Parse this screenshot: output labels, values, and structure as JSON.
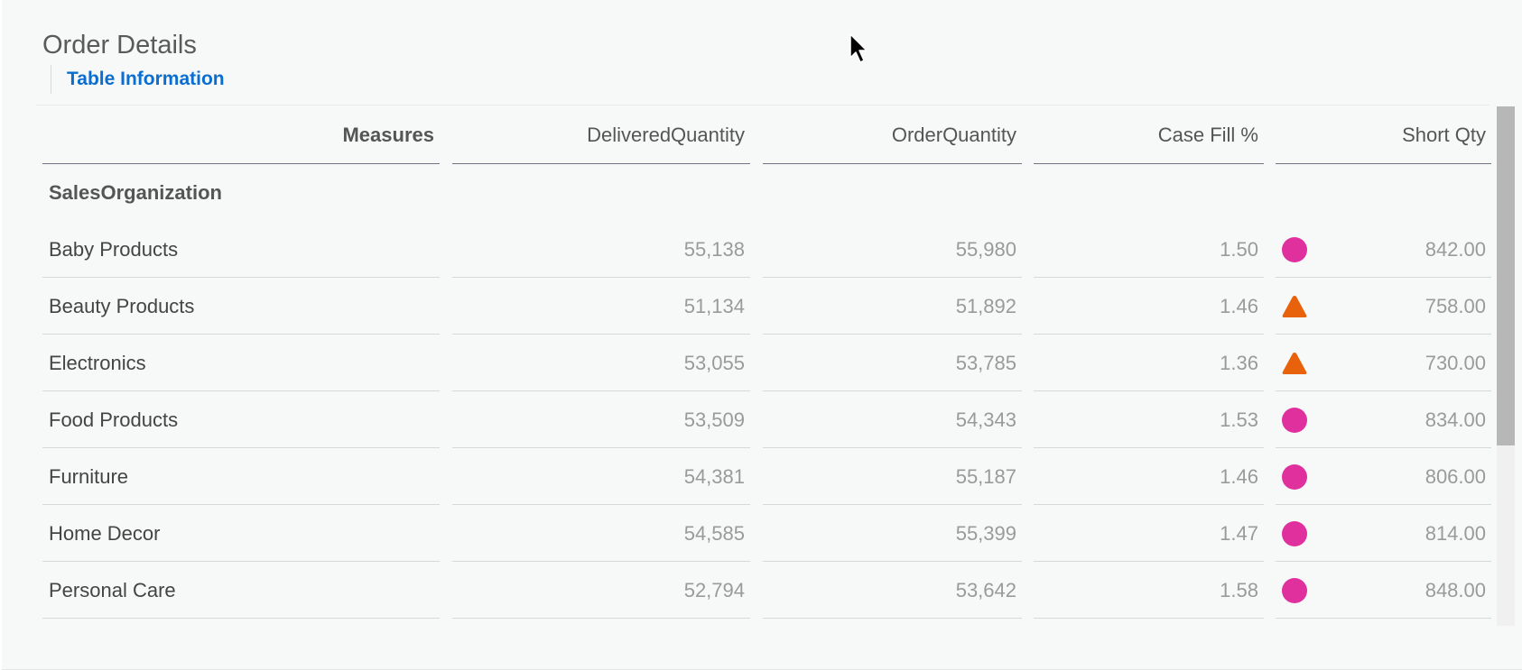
{
  "panel": {
    "title": "Order Details",
    "subnav_link": "Table Information"
  },
  "table": {
    "headers": [
      "Measures",
      "DeliveredQuantity",
      "OrderQuantity",
      "Case Fill %",
      "Short Qty"
    ],
    "group_label": "SalesOrganization",
    "rows": [
      {
        "label": "Baby Products",
        "delivered": "55,138",
        "ordered": "55,980",
        "case_fill": "1.50",
        "indicator": "circle",
        "indicator_color": "#e0309e",
        "short_qty": "842.00"
      },
      {
        "label": "Beauty Products",
        "delivered": "51,134",
        "ordered": "51,892",
        "case_fill": "1.46",
        "indicator": "triangle",
        "indicator_color": "#e8620c",
        "short_qty": "758.00"
      },
      {
        "label": "Electronics",
        "delivered": "53,055",
        "ordered": "53,785",
        "case_fill": "1.36",
        "indicator": "triangle",
        "indicator_color": "#e8620c",
        "short_qty": "730.00"
      },
      {
        "label": "Food Products",
        "delivered": "53,509",
        "ordered": "54,343",
        "case_fill": "1.53",
        "indicator": "circle",
        "indicator_color": "#e0309e",
        "short_qty": "834.00"
      },
      {
        "label": "Furniture",
        "delivered": "54,381",
        "ordered": "55,187",
        "case_fill": "1.46",
        "indicator": "circle",
        "indicator_color": "#e0309e",
        "short_qty": "806.00"
      },
      {
        "label": "Home Decor",
        "delivered": "54,585",
        "ordered": "55,399",
        "case_fill": "1.47",
        "indicator": "circle",
        "indicator_color": "#e0309e",
        "short_qty": "814.00"
      },
      {
        "label": "Personal Care",
        "delivered": "52,794",
        "ordered": "53,642",
        "case_fill": "1.58",
        "indicator": "circle",
        "indicator_color": "#e0309e",
        "short_qty": "848.00"
      }
    ]
  },
  "colors": {
    "accent": "#0a6ed1",
    "circle_indicator": "#e0309e",
    "triangle_indicator": "#e8620c"
  }
}
